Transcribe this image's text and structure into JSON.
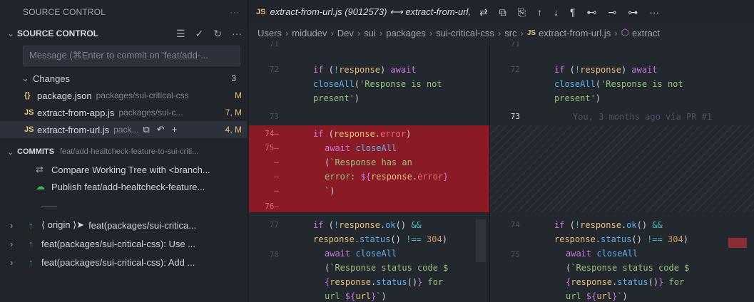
{
  "sidebar": {
    "title": "SOURCE CONTROL",
    "more": "···",
    "section_title": "SOURCE CONTROL",
    "tool_list": "☰",
    "tool_commit": "✓",
    "tool_refresh": "↻",
    "tool_more": "···",
    "message_placeholder": "Message (⌘Enter to commit on 'feat/add-...",
    "changes_label": "Changes",
    "changes_count": "3",
    "files": [
      {
        "icon": "{}",
        "name": "package.json",
        "path": "packages/sui-critical-css",
        "status": "M"
      },
      {
        "icon": "JS",
        "name": "extract-from-app.js",
        "path": "packages/sui-c...",
        "status": "7, M"
      },
      {
        "icon": "JS",
        "name": "extract-from-url.js",
        "path": "pack...",
        "status": "4, M"
      }
    ],
    "commits_label": "COMMITS",
    "commits_branch": "feat/add-healtcheck-feature-to-sui-criti...",
    "commit_items": [
      {
        "icon": "⇄",
        "label": "Compare Working Tree with <branch..."
      },
      {
        "icon": "☁",
        "label": "Publish feat/add-healtcheck-feature..."
      }
    ],
    "history": [
      {
        "ref": "⟨ origin ⟩➤",
        "label": "feat(packages/sui-critica..."
      },
      {
        "ref": "",
        "label": "feat(packages/sui-critical-css): Use ..."
      },
      {
        "ref": "",
        "label": "feat(packages/sui-critical-css): Add ..."
      }
    ]
  },
  "editor": {
    "tab_lang": "JS",
    "tab_title": "extract-from-url.js (9012573) ⟷ extract-from-url,",
    "crumbs": [
      "Users",
      "midudev",
      "Dev",
      "sui",
      "packages",
      "sui-critical-css",
      "src"
    ],
    "crumb_file": "extract-from-url.js",
    "crumb_tail": "extract",
    "left_lines": [
      "71",
      "72",
      "",
      "73",
      "74—",
      "75—",
      "—",
      "—",
      "—",
      "76—",
      "77",
      "",
      "78",
      "",
      "",
      ""
    ],
    "right_lines": [
      "71",
      "72",
      "",
      "",
      "73",
      "",
      "",
      "",
      "",
      "",
      "74",
      "",
      "75",
      "",
      "",
      ""
    ],
    "blame": "You, 3 months ago via PR #1"
  },
  "colors": {
    "accent_js": "#e5c07b",
    "deleted_bg": "#8b1a27",
    "added_green": "#3fb950"
  }
}
